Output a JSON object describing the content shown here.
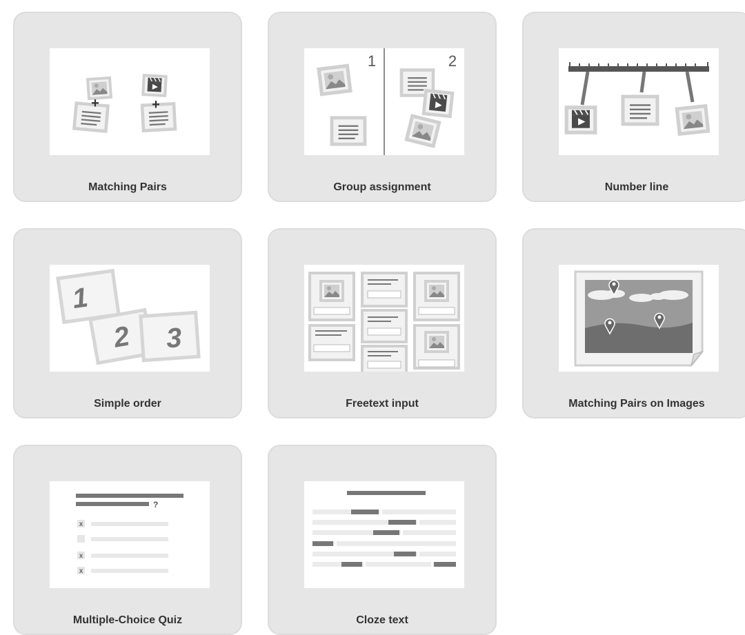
{
  "colors": {
    "card_bg": "#e6e6e6",
    "card_border": "#dcdcdc",
    "label": "#333333",
    "thumb_bg": "#ffffff"
  },
  "templates": [
    {
      "label": "Matching Pairs",
      "icon": "matching-pairs-icon"
    },
    {
      "label": "Group assignment",
      "icon": "group-assignment-icon",
      "group_numbers": [
        "1",
        "2"
      ]
    },
    {
      "label": "Number line",
      "icon": "number-line-icon"
    },
    {
      "label": "Simple order",
      "icon": "simple-order-icon",
      "order_numbers": [
        "1",
        "2",
        "3"
      ]
    },
    {
      "label": "Freetext input",
      "icon": "freetext-input-icon"
    },
    {
      "label": "Matching Pairs on Images",
      "icon": "map-pins-icon"
    },
    {
      "label": "Multiple-Choice Quiz",
      "icon": "multiple-choice-icon",
      "question_mark": "?",
      "cross": "x"
    },
    {
      "label": "Cloze text",
      "icon": "cloze-text-icon"
    }
  ]
}
